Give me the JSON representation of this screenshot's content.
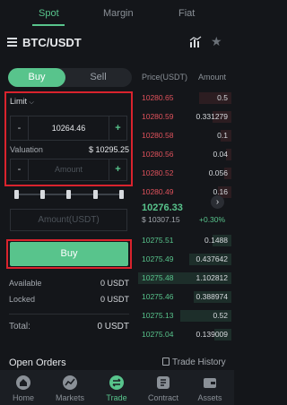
{
  "top_tabs": [
    "Spot",
    "Margin",
    "Fiat"
  ],
  "pair": "BTC/USDT",
  "buy_tab": "Buy",
  "sell_tab": "Sell",
  "order_type": "Limit",
  "price_value": "10264.46",
  "valuation_label": "Valuation",
  "valuation_value": "$ 10295.25",
  "amount_placeholder": "Amount",
  "amount_usdt_placeholder": "Amount(USDT)",
  "buy_button": "Buy",
  "available_label": "Available",
  "available_value": "0 USDT",
  "locked_label": "Locked",
  "locked_value": "0 USDT",
  "total_label": "Total:",
  "total_value": "0 USDT",
  "order_book": {
    "price_header": "Price(USDT)",
    "amount_header": "Amount",
    "asks": [
      {
        "price": "10280.65",
        "amount": "0.5",
        "depth": 0.35
      },
      {
        "price": "10280.59",
        "amount": "0.331279",
        "depth": 0.2
      },
      {
        "price": "10280.58",
        "amount": "0.1",
        "depth": 0.12
      },
      {
        "price": "10280.56",
        "amount": "0.04",
        "depth": 0.06
      },
      {
        "price": "10280.52",
        "amount": "0.056",
        "depth": 0.08
      },
      {
        "price": "10280.49",
        "amount": "0.16",
        "depth": 0.14
      }
    ],
    "last_price": "10276.33",
    "last_usd": "$ 10307.15",
    "change": "+0.30%",
    "bids": [
      {
        "price": "10275.51",
        "amount": "0.1488",
        "depth": 0.2
      },
      {
        "price": "10275.49",
        "amount": "0.437642",
        "depth": 0.45
      },
      {
        "price": "10275.48",
        "amount": "1.102812",
        "depth": 1.0
      },
      {
        "price": "10275.46",
        "amount": "0.388974",
        "depth": 0.4
      },
      {
        "price": "10275.13",
        "amount": "0.52",
        "depth": 0.55
      },
      {
        "price": "10275.04",
        "amount": "0.139009",
        "depth": 0.18
      }
    ]
  },
  "open_orders": "Open Orders",
  "trade_history": "Trade History",
  "bottom_nav": [
    "Home",
    "Markets",
    "Trade",
    "Contract",
    "Assets"
  ],
  "colors": {
    "accent": "#58c48c",
    "ask": "#e0525c",
    "highlight": "#d9232d"
  }
}
